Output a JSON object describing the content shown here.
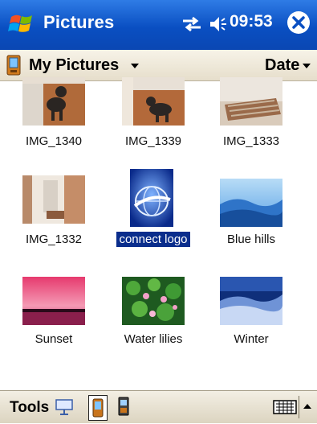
{
  "titlebar": {
    "title": "Pictures",
    "time": "09:53"
  },
  "folder": {
    "name": "My Pictures",
    "sort": "Date"
  },
  "pictures": [
    {
      "name": "IMG_1340"
    },
    {
      "name": "IMG_1339"
    },
    {
      "name": "IMG_1333"
    },
    {
      "name": "IMG_1332"
    },
    {
      "name": "connect logo",
      "selected": true
    },
    {
      "name": "Blue hills"
    },
    {
      "name": "Sunset"
    },
    {
      "name": "Water lilies"
    },
    {
      "name": "Winter"
    }
  ],
  "bottombar": {
    "tools_label": "Tools"
  },
  "colors": {
    "titlebar": "#0a4fc2",
    "selection": "#0a2d8c",
    "bar": "#e6decb"
  }
}
